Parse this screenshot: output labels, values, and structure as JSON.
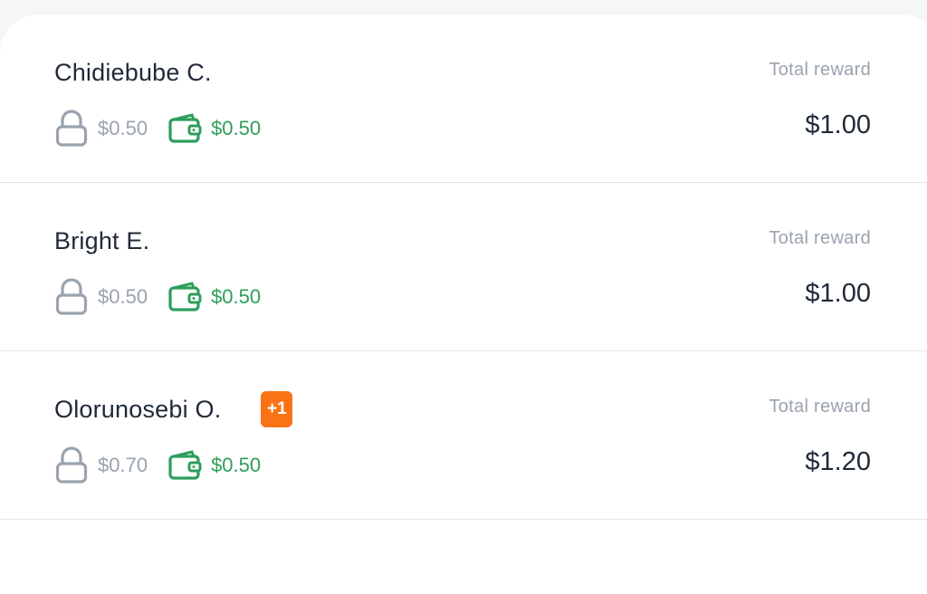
{
  "rewards": [
    {
      "name": "Chidiebube C.",
      "badge": "",
      "locked": "$0.50",
      "available": "$0.50",
      "total_label": "Total reward",
      "total": "$1.00"
    },
    {
      "name": "Bright E.",
      "badge": "",
      "locked": "$0.50",
      "available": "$0.50",
      "total_label": "Total reward",
      "total": "$1.00"
    },
    {
      "name": "Olorunosebi O.",
      "badge": "+1",
      "locked": "$0.70",
      "available": "$0.50",
      "total_label": "Total reward",
      "total": "$1.20"
    }
  ],
  "colors": {
    "locked": "#9aa3af",
    "available": "#2e9e5b",
    "badge": "#f97316",
    "name": "#1f2a37"
  },
  "icons": {
    "locked": "lock-icon",
    "available": "wallet-icon"
  }
}
